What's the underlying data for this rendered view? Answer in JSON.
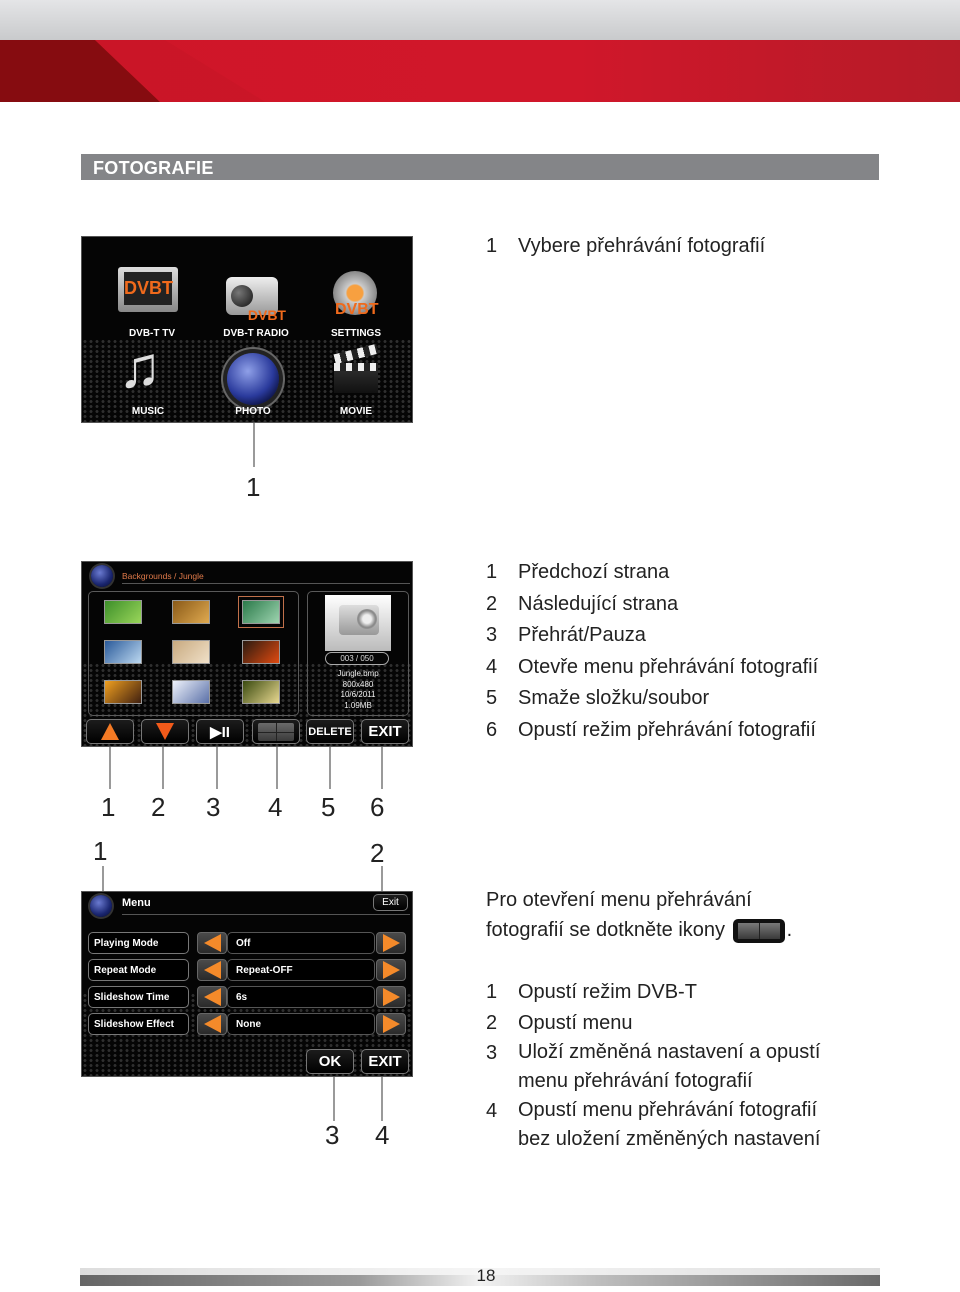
{
  "section_title": "FOTOGRAFIE",
  "main_menu": {
    "items": [
      {
        "label": "DVB-T TV",
        "icon": "tv-icon",
        "badge": "DVBT"
      },
      {
        "label": "DVB-T RADIO",
        "icon": "radio-icon",
        "badge": "DVBT"
      },
      {
        "label": "SETTINGS",
        "icon": "gear-icon",
        "badge": "DVBT"
      },
      {
        "label": "MUSIC",
        "icon": "music-note-icon"
      },
      {
        "label": "PHOTO",
        "icon": "photo-orb-icon"
      },
      {
        "label": "MOVIE",
        "icon": "clapperboard-icon"
      }
    ],
    "callout": "1",
    "description": [
      {
        "num": "1",
        "text": "Vybere přehrávání fotografií"
      }
    ]
  },
  "photo_browser": {
    "breadcrumb": "Backgrounds / Jungle",
    "counter": "003 / 050",
    "file_info": {
      "name": "Jungle.bmp",
      "resolution": "800x480",
      "date": "10/6/2011",
      "size": "1.09MB"
    },
    "thumbnails": [
      {
        "name": "green-leaf",
        "colors": [
          "#3d8f2a",
          "#9ad65a"
        ]
      },
      {
        "name": "golden-texture",
        "colors": [
          "#8a5a18",
          "#e0aa50"
        ]
      },
      {
        "name": "green-leaves",
        "colors": [
          "#2b7a4a",
          "#9ed4b0"
        ],
        "selected": true
      },
      {
        "name": "blue-ice",
        "colors": [
          "#2a5a9a",
          "#bcd8f0"
        ]
      },
      {
        "name": "desert-dunes",
        "colors": [
          "#c8aa80",
          "#f0e0c8"
        ]
      },
      {
        "name": "volcano",
        "colors": [
          "#2a1a10",
          "#e04a10"
        ]
      },
      {
        "name": "sunset-coast",
        "colors": [
          "#f0a020",
          "#402010"
        ]
      },
      {
        "name": "mountain-haze",
        "colors": [
          "#eef2fa",
          "#5a70a8"
        ]
      },
      {
        "name": "autumn-tree",
        "colors": [
          "#3a4a10",
          "#e8d890"
        ]
      }
    ],
    "buttons": {
      "prev": "previous-page",
      "next": "next-page",
      "play_pause": "▶II",
      "menu": "menu",
      "delete": "DELETE",
      "exit": "EXIT"
    },
    "callouts": [
      "1",
      "2",
      "3",
      "4",
      "5",
      "6"
    ],
    "description": [
      {
        "num": "1",
        "text": "Předchozí strana"
      },
      {
        "num": "2",
        "text": "Následující strana"
      },
      {
        "num": "3",
        "text": "Přehrát/Pauza"
      },
      {
        "num": "4",
        "text": "Otevře menu přehrávání fotografií"
      },
      {
        "num": "5",
        "text": "Smaže složku/soubor"
      },
      {
        "num": "6",
        "text": "Opustí režim přehrávání fotografií"
      }
    ]
  },
  "settings_menu": {
    "title": "Menu",
    "exit_small": "Exit",
    "rows": [
      {
        "label": "Playing Mode",
        "value": "Off"
      },
      {
        "label": "Repeat Mode",
        "value": "Repeat-OFF"
      },
      {
        "label": "Slideshow Time",
        "value": "6s"
      },
      {
        "label": "Slideshow Effect",
        "value": "None"
      }
    ],
    "ok": "OK",
    "exit": "EXIT",
    "callouts_top": [
      "1",
      "2"
    ],
    "callouts_bottom": [
      "3",
      "4"
    ],
    "intro_line1": "Pro otevření menu přehrávání",
    "intro_line2": "fotografií se dotkněte ikony",
    "intro_end": ".",
    "description": [
      {
        "num": "1",
        "text": "Opustí režim DVB-T"
      },
      {
        "num": "2",
        "text": "Opustí menu"
      },
      {
        "num": "3",
        "text": "Uloží změněná nastavení a opustí",
        "text2": "menu přehrávání fotografií"
      },
      {
        "num": "4",
        "text": "Opustí menu přehrávání fotografií",
        "text2": "bez uložení změněných nastavení"
      }
    ]
  },
  "page_number": "18",
  "colors": {
    "brand_red": "#cf1628",
    "section_grey": "#848588",
    "accent_orange": "#f47a24"
  }
}
